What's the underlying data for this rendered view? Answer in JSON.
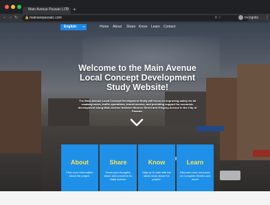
{
  "browser": {
    "tab_title": "Main Avenue Passaic LCD",
    "url": "mainavepassaic.com",
    "profile_label": "Incognito"
  },
  "nav": {
    "language": "English",
    "items": [
      "Home",
      "About",
      "Share",
      "Know",
      "Learn",
      "Contact"
    ]
  },
  "hero": {
    "title": "Welcome to the Main Avenue Local Concept Development Study Website!",
    "subtitle": "The Main Avenue Local Concept Development Study will focus on improving safety for all roadway users, traffic operations, transit access, and providing support for economic development along Main Avenue between Monroe Street and Gregory Avenue in the City of Passaic."
  },
  "cards": [
    {
      "title": "About",
      "desc": "Find more information about the project."
    },
    {
      "title": "Share",
      "desc": "Share your thoughts, vision and concerns for Main Avenue"
    },
    {
      "title": "Know",
      "desc": "Stay up to date with the latest news about the project."
    },
    {
      "title": "Learn",
      "desc": "Discover more resources on Complete Streets and more!"
    }
  ],
  "colors": {
    "accent": "#1e90e8",
    "card_title": "#ffe14d"
  }
}
